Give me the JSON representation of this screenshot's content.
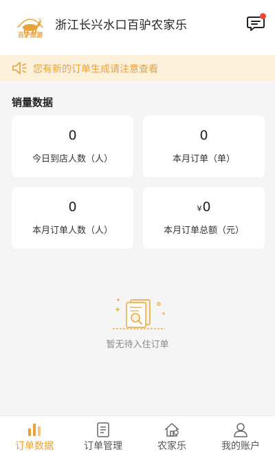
{
  "header": {
    "logo_text": "百驴旅游",
    "title": "浙江长兴水口百驴农家乐"
  },
  "notice": {
    "text": "您有新的订单生成请注意查看"
  },
  "stats": {
    "section_title": "销量数据",
    "cards": [
      {
        "value": "0",
        "label": "今日到店人数（人）"
      },
      {
        "value": "0",
        "label": "本月订单（单）"
      },
      {
        "value": "0",
        "label": "本月订单人数（人）"
      },
      {
        "currency": "¥",
        "value": "0",
        "label": "本月订单总额（元）"
      }
    ]
  },
  "empty": {
    "text": "暂无待入住订单"
  },
  "tabbar": {
    "items": [
      {
        "label": "订单数据",
        "icon": "bar-chart-icon",
        "active": true
      },
      {
        "label": "订单管理",
        "icon": "document-icon",
        "active": false
      },
      {
        "label": "农家乐",
        "icon": "house-icon",
        "active": false
      },
      {
        "label": "我的账户",
        "icon": "user-icon",
        "active": false
      }
    ]
  },
  "colors": {
    "accent": "#e8a23a",
    "notice_bg": "#fdf1dc",
    "badge": "#f0463a"
  }
}
